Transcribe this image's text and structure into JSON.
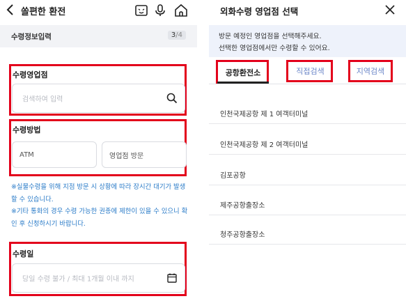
{
  "left": {
    "header": {
      "title": "쏠편한 환전"
    },
    "step": {
      "label": "수령정보입력",
      "current": "3",
      "total": "/4"
    },
    "branch": {
      "title": "수령영업점",
      "placeholder": "검색하여 입력"
    },
    "method": {
      "title": "수령방법",
      "options": [
        "ATM",
        "영업점 방문"
      ]
    },
    "notices": [
      "※실물수령을 위해 지점 방문 시 상황에 따라 장시간 대기가 발생할 수 있습니다.",
      "※기타 통화의 경우 수령 가능한 권종에 제한이 있을 수 있으니 확인 후 신청하시기 바랍니다."
    ],
    "date": {
      "title": "수령일",
      "placeholder": "당일 수령 불가 / 최대 1개월 이내 까지"
    }
  },
  "right": {
    "header": {
      "title": "외화수령 영업점 선택"
    },
    "info": [
      "방문 예정인 영업점을 선택해주세요.",
      "선택한 영업점에서만 수령할 수 있어요."
    ],
    "tabs": [
      "공항환전소",
      "직접검색",
      "지역검색"
    ],
    "items": [
      "인천국제공항 제 1 여객터미널",
      "인천국제공항 제 2 여객터미널",
      "김포공항",
      "제주공항출장소",
      "청주공항출장소"
    ]
  },
  "colors": {
    "highlight": "#e3001b",
    "notice": "#2a7bc8",
    "tab_inactive": "#6a86c8"
  }
}
